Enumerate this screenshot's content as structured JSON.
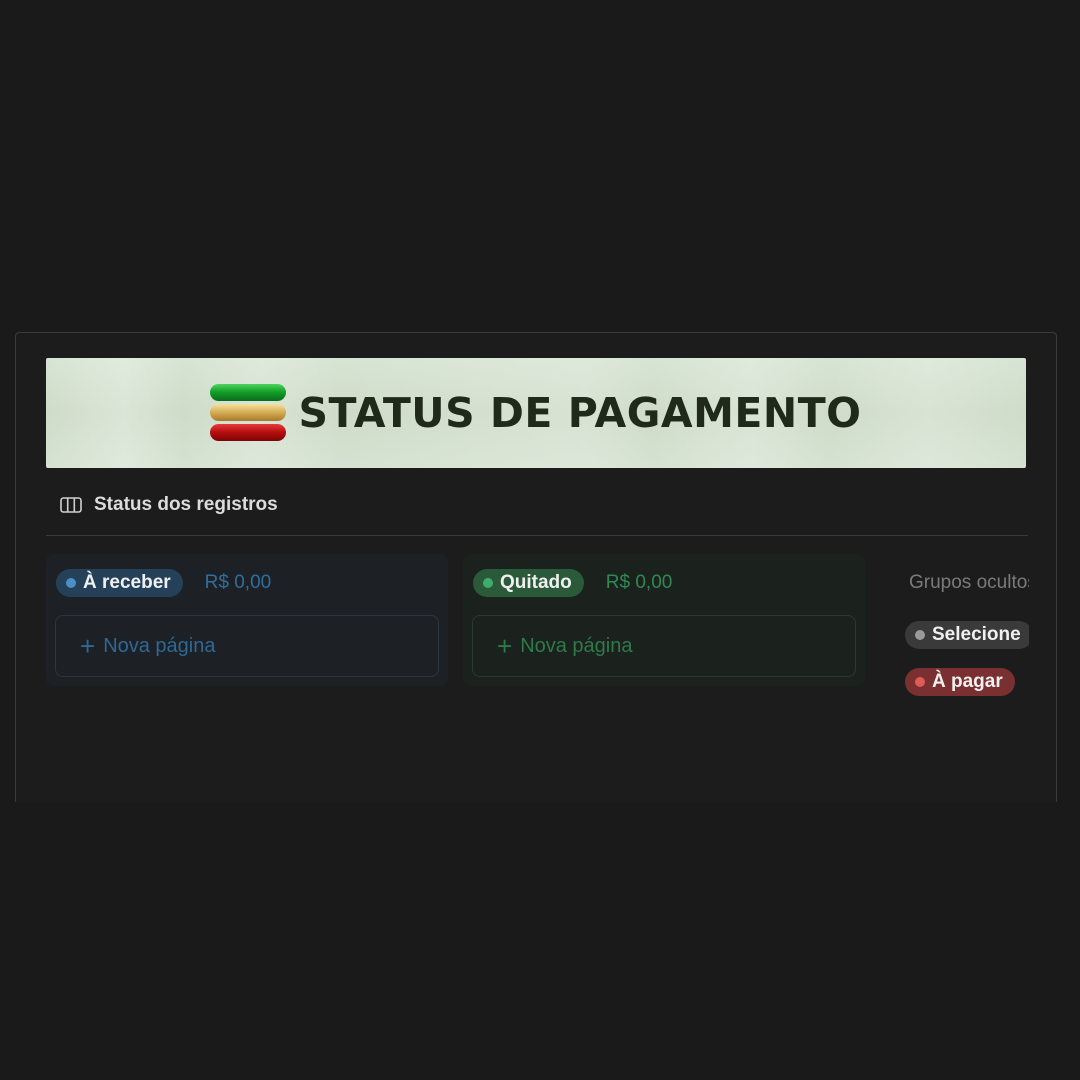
{
  "banner": {
    "title": "STATUS DE PAGAMENTO",
    "logo_icon": "stacked-bars-icon"
  },
  "view": {
    "icon": "board-view-icon",
    "label": "Status dos registros"
  },
  "columns": [
    {
      "status": "À receber",
      "amount": "R$ 0,00",
      "new_page_label": "Nova página",
      "color": "#4a90c8"
    },
    {
      "status": "Quitado",
      "amount": "R$ 0,00",
      "new_page_label": "Nova página",
      "color": "#3fae6a"
    }
  ],
  "hidden_groups": {
    "label": "Grupos ocultos",
    "items": [
      {
        "label": "Selecione",
        "color": "#9a9a9a"
      },
      {
        "label": "À pagar",
        "color": "#e05a5a"
      }
    ]
  }
}
